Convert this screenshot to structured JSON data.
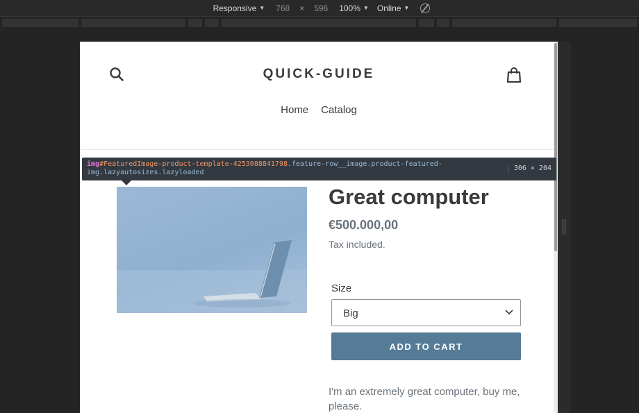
{
  "devtools": {
    "device_mode": "Responsive",
    "width": "768",
    "height": "596",
    "times": "×",
    "zoom": "100%",
    "network": "Online"
  },
  "shop": {
    "title": "QUICK-GUIDE",
    "nav": [
      "Home",
      "Catalog"
    ]
  },
  "inspector": {
    "tag": "img",
    "id": "#FeaturedImage-product-template-4253088841798",
    "classes": ".feature-row__image.product-featured-img.lazyautosizes.lazyloaded",
    "size": "306 × 204"
  },
  "product": {
    "title": "Great computer",
    "price": "€500.000,00",
    "tax_note": "Tax included.",
    "size_label": "Size",
    "size_value": "Big",
    "add_to_cart": "ADD TO CART",
    "description": "I'm an extremely great computer, buy me, please."
  },
  "colors": {
    "button": "#557b97",
    "text_dark": "#3a3a3a",
    "text_muted": "#69727b"
  }
}
